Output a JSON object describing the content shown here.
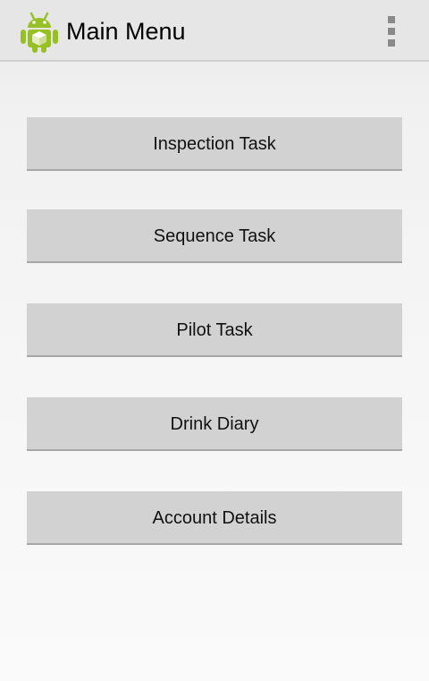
{
  "action_bar": {
    "title": "Main Menu",
    "app_icon": "android-icon",
    "overflow_icon": "overflow-menu-icon"
  },
  "menu": {
    "buttons": [
      {
        "label": "Inspection Task"
      },
      {
        "label": "Sequence Task"
      },
      {
        "label": "Pilot Task"
      },
      {
        "label": "Drink Diary"
      },
      {
        "label": "Account Details"
      }
    ]
  },
  "colors": {
    "action_bar_bg": "#e6e6e6",
    "button_bg": "#d2d2d2",
    "android_green": "#97c024"
  }
}
